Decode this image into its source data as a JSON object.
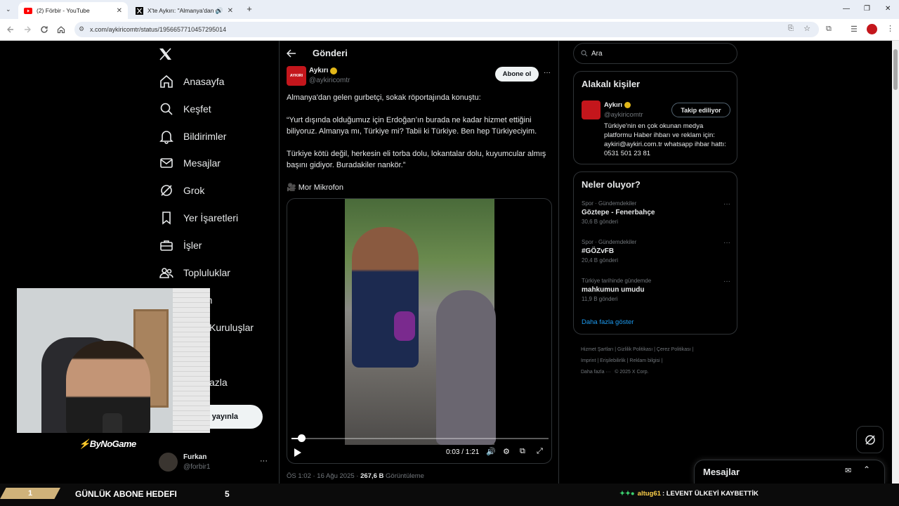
{
  "browser": {
    "tabs": [
      {
        "title": "(2) Förbir - YouTube",
        "icon": "youtube-icon",
        "active": true
      },
      {
        "title": "X'te Aykırı: \"Almanya'dan gı",
        "icon": "x-icon",
        "active": false
      }
    ],
    "url": "x.com/aykiricomtr/status/1956657710457295014"
  },
  "sidebar": {
    "items": [
      {
        "label": "Anasayfa",
        "icon": "home-icon"
      },
      {
        "label": "Keşfet",
        "icon": "search-icon"
      },
      {
        "label": "Bildirimler",
        "icon": "bell-icon"
      },
      {
        "label": "Mesajlar",
        "icon": "mail-icon"
      },
      {
        "label": "Grok",
        "icon": "grok-icon"
      },
      {
        "label": "Yer İşaretleri",
        "icon": "bookmark-icon"
      },
      {
        "label": "İşler",
        "icon": "briefcase-icon"
      },
      {
        "label": "Topluluklar",
        "icon": "people-icon"
      }
    ],
    "partial_items": [
      "um",
      "Kuruluşlar",
      "azla"
    ],
    "post_button_partial": "yayınla",
    "account": {
      "name": "Furkan",
      "handle": "@forbir1"
    }
  },
  "post": {
    "header_title": "Gönderi",
    "author_name": "Aykırı",
    "author_handle": "@aykiricomtr",
    "follow_label": "Abone ol",
    "avatar_text": "AYKIRI",
    "paragraphs": [
      "Almanya'dan gelen gurbetçi, sokak röportajında konuştu:",
      "“Yurt dışında olduğumuz için Erdoğan’ın burada ne kadar hizmet ettiğini biliyoruz. Almanya mı, Türkiye mi? Tabii ki Türkiye. Ben hep Türkiyeciyim.",
      "Türkiye kötü değil, herkesin eli torba dolu, lokantalar dolu, kuyumcular almış başını gidiyor. Buradakiler nankör.”",
      "🎥 Mor Mikrofon"
    ],
    "video": {
      "time": "0:03 / 1:21",
      "progress": 0.037
    },
    "meta_time": "ÖS 1:02 · 16 Ağu 2025 · ",
    "views_count": "267,6 B",
    "views_label": "Görüntüleme"
  },
  "search": {
    "placeholder": "Ara"
  },
  "related": {
    "title": "Alakalı kişiler",
    "name": "Aykırı",
    "handle": "@aykiricomtr",
    "button": "Takip ediliyor",
    "bio": "Türkiye'nin en çok okunan medya platformu Haber ihbarı ve reklam için: aykiri@aykiri.com.tr whatsapp ihbar hattı: 0531 501 23 81"
  },
  "trends": {
    "title": "Neler oluyor?",
    "items": [
      {
        "context": "Spor · Gündemdekiler",
        "name": "Göztepe - Fenerbahçe",
        "count": "30,6 B gönderi"
      },
      {
        "context": "Spor · Gündemdekiler",
        "name": "#GÖZvFB",
        "count": "20,4 B gönderi"
      },
      {
        "context": "Türkiye tarihinde gündemde",
        "name": "mahkumun umudu",
        "count": "11,9 B gönderi"
      }
    ],
    "show_more": "Daha fazla göster"
  },
  "footer": {
    "line1": [
      "Hizmet Şartları",
      "Gizlilik Politikası",
      "Çerez Politikası"
    ],
    "line2": [
      "Imprint",
      "Erişilebilirlik",
      "Reklam bilgisi"
    ],
    "more": "Daha fazla ···",
    "copyright": "© 2025 X Corp."
  },
  "messages_drawer": {
    "title": "Mesajlar"
  },
  "stream": {
    "brand": "ByNoGame",
    "goal_current": "1",
    "goal_label": "GÜNLÜK ABONE HEDEFI",
    "goal_target": "5",
    "chat_user": "altug61",
    "chat_message": ": LEVENT ÜLKEYİ KAYBETTİK"
  },
  "colors": {
    "accent": "#1d9bf0",
    "verified": "#e2b719",
    "brand_red": "#c4161c",
    "tab_bg": "#e9eef6"
  }
}
